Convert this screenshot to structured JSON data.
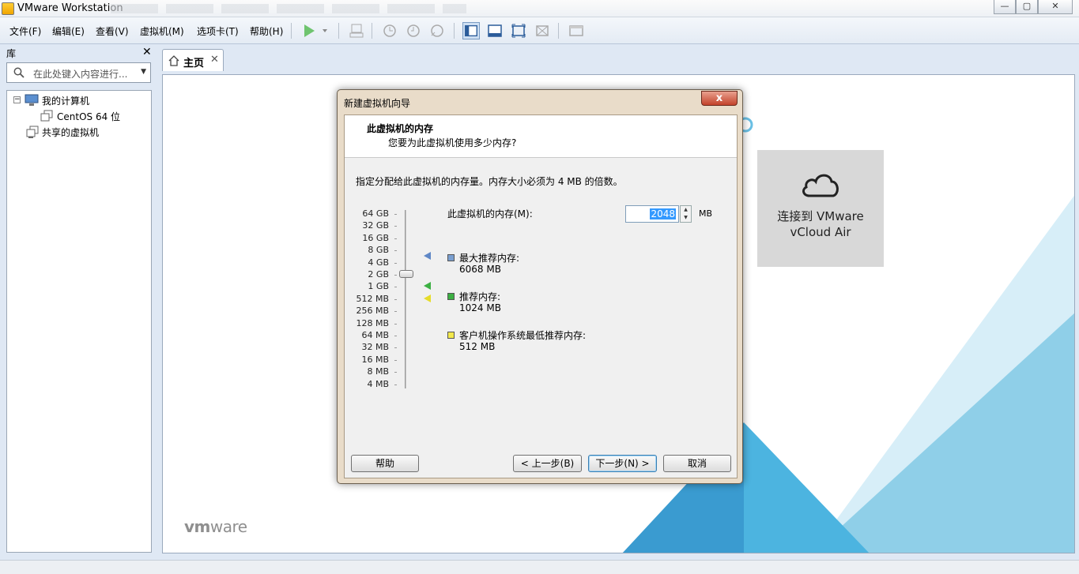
{
  "window": {
    "title": "VMware Workstation",
    "min": "—",
    "max": "▢",
    "close": "✕"
  },
  "menu": {
    "items": [
      "文件(F)",
      "编辑(E)",
      "查看(V)",
      "虚拟机(M)",
      "选项卡(T)",
      "帮助(H)"
    ]
  },
  "library": {
    "title": "库",
    "close": "✕",
    "search_placeholder": "在此处键入内容进行...",
    "tree": {
      "my_computer": "我的计算机",
      "vm_name": "CentOS 64 位",
      "shared": "共享的虚拟机"
    }
  },
  "tabs": [
    {
      "label": "主页",
      "close": "✕"
    }
  ],
  "home": {
    "tile_label_line1": "连接到 VMware",
    "tile_label_line2": "vCloud Air",
    "logo_vm": "vm",
    "logo_ware": "ware"
  },
  "dialog": {
    "title": "新建虚拟机向导",
    "close": "x",
    "header_title": "此虚拟机的内存",
    "header_subtitle": "您要为此虚拟机使用多少内存?",
    "description": "指定分配给此虚拟机的内存量。内存大小必须为 4 MB 的倍数。",
    "scale": [
      "64 GB",
      "32 GB",
      "16 GB",
      "8 GB",
      "4 GB",
      "2 GB",
      "1 GB",
      "512 MB",
      "256 MB",
      "128 MB",
      "64 MB",
      "32 MB",
      "16 MB",
      "8 MB",
      "4 MB"
    ],
    "memory_label": "此虚拟机的内存(M):",
    "memory_value": "2048",
    "memory_unit": "MB",
    "max_recommended_label": "最大推荐内存:",
    "max_recommended_value": "6068 MB",
    "recommended_label": "推荐内存:",
    "recommended_value": "1024 MB",
    "min_recommended_label": "客户机操作系统最低推荐内存:",
    "min_recommended_value": "512 MB",
    "colors": {
      "max": "#7a9fd0",
      "recommended": "#3cb043",
      "min": "#f2e84c"
    },
    "buttons": {
      "help": "帮助",
      "back": "< 上一步(B)",
      "next": "下一步(N) >",
      "cancel": "取消"
    }
  }
}
